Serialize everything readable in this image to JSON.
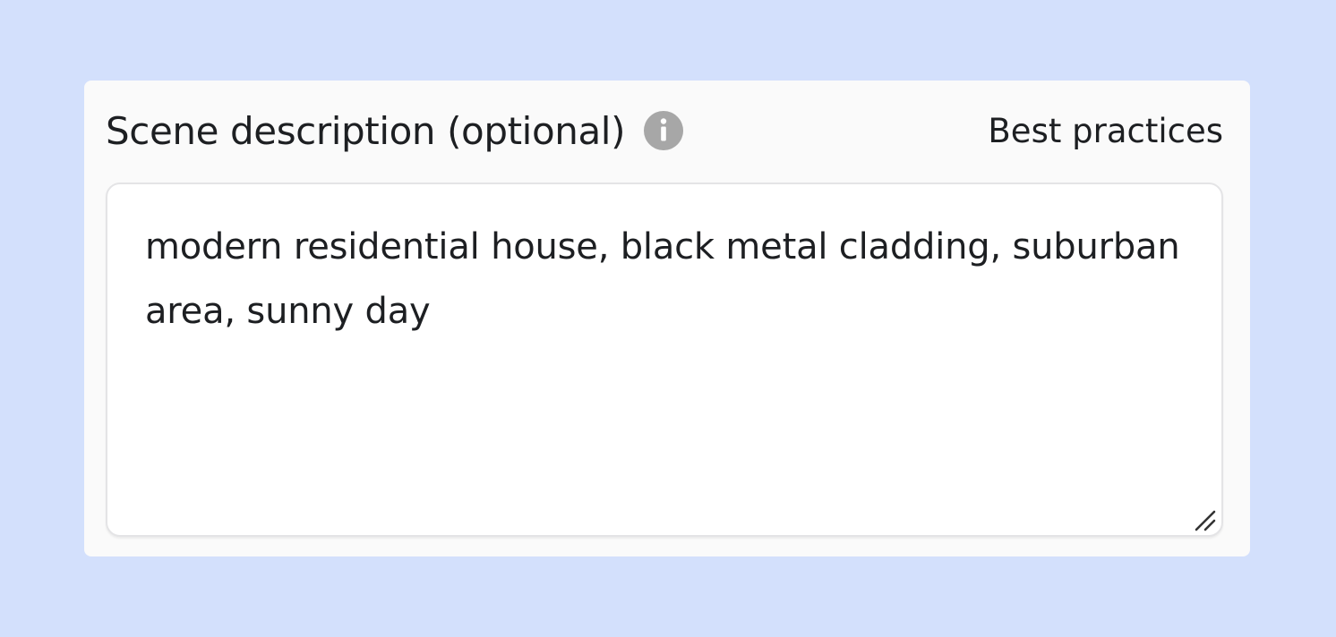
{
  "field": {
    "label": "Scene description (optional)",
    "info_icon": "info-icon",
    "best_practices_label": "Best practices",
    "value": "modern residential house, black metal cladding, suburban area, sunny day",
    "resize_icon": "resize-handle-icon"
  },
  "colors": {
    "page_background": "#d3e0fc",
    "panel_background": "#fafafa",
    "textarea_background": "#ffffff",
    "text": "#1d1f22",
    "info_icon": "#a7a7a7"
  }
}
